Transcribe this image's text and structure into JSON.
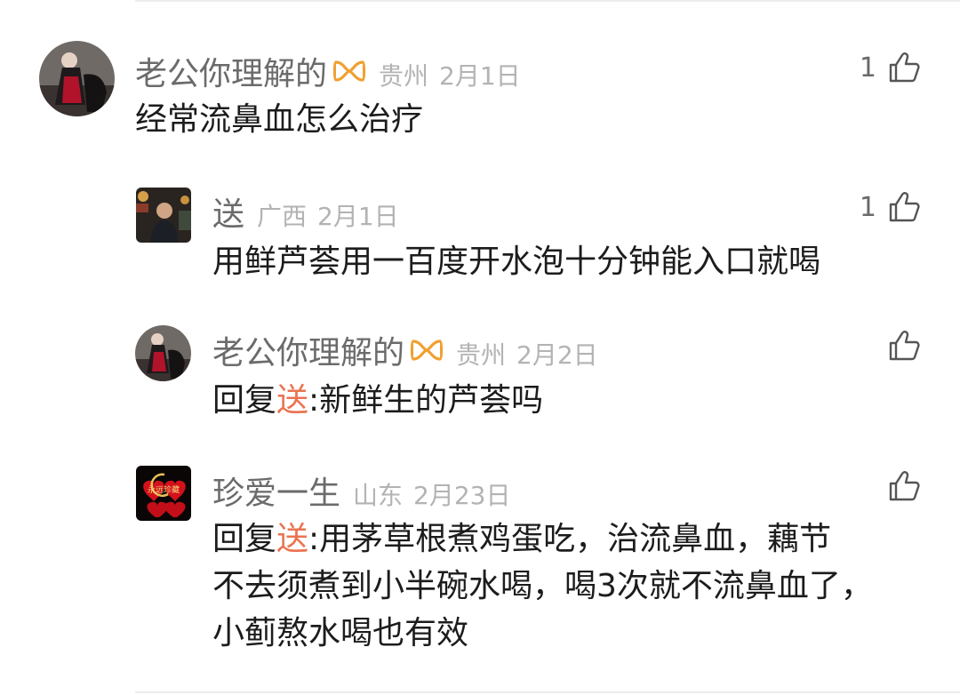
{
  "colors": {
    "username": "#6b6b6b",
    "meta": "#b3b3b3",
    "text": "#1c1c1c",
    "reply_name": "#eb7350",
    "badge": "#f0a030",
    "divider": "#ececec"
  },
  "icons": {
    "badge": "orange-infinity-badge-icon",
    "like": "thumbs-up-icon"
  },
  "comments": [
    {
      "username": "老公你理解的",
      "has_badge": true,
      "location": "贵州",
      "date": "2月1日",
      "text": "经常流鼻血怎么治疗",
      "likes": "1"
    },
    {
      "username": "送",
      "has_badge": false,
      "location": "广西",
      "date": "2月1日",
      "text": "用鲜芦荟用一百度开水泡十分钟能入口就喝",
      "likes": "1"
    },
    {
      "username": "老公你理解的",
      "has_badge": true,
      "location": "贵州",
      "date": "2月2日",
      "reply_prefix": "回复",
      "reply_to": "送",
      "reply_colon": ":",
      "text": "新鲜生的芦荟吗",
      "likes": ""
    },
    {
      "username": "珍爱一生",
      "has_badge": false,
      "location": "山东",
      "date": "2月23日",
      "avatar_text": "永远珍藏",
      "reply_prefix": "回复",
      "reply_to": "送",
      "reply_colon": ":",
      "text_lines": [
        "用茅草根煮鸡蛋吃，治流鼻血，藕节",
        "不去须煮到小半碗水喝，喝3次就不流鼻血了，",
        "小蓟熬水喝也有效"
      ],
      "likes": ""
    }
  ]
}
